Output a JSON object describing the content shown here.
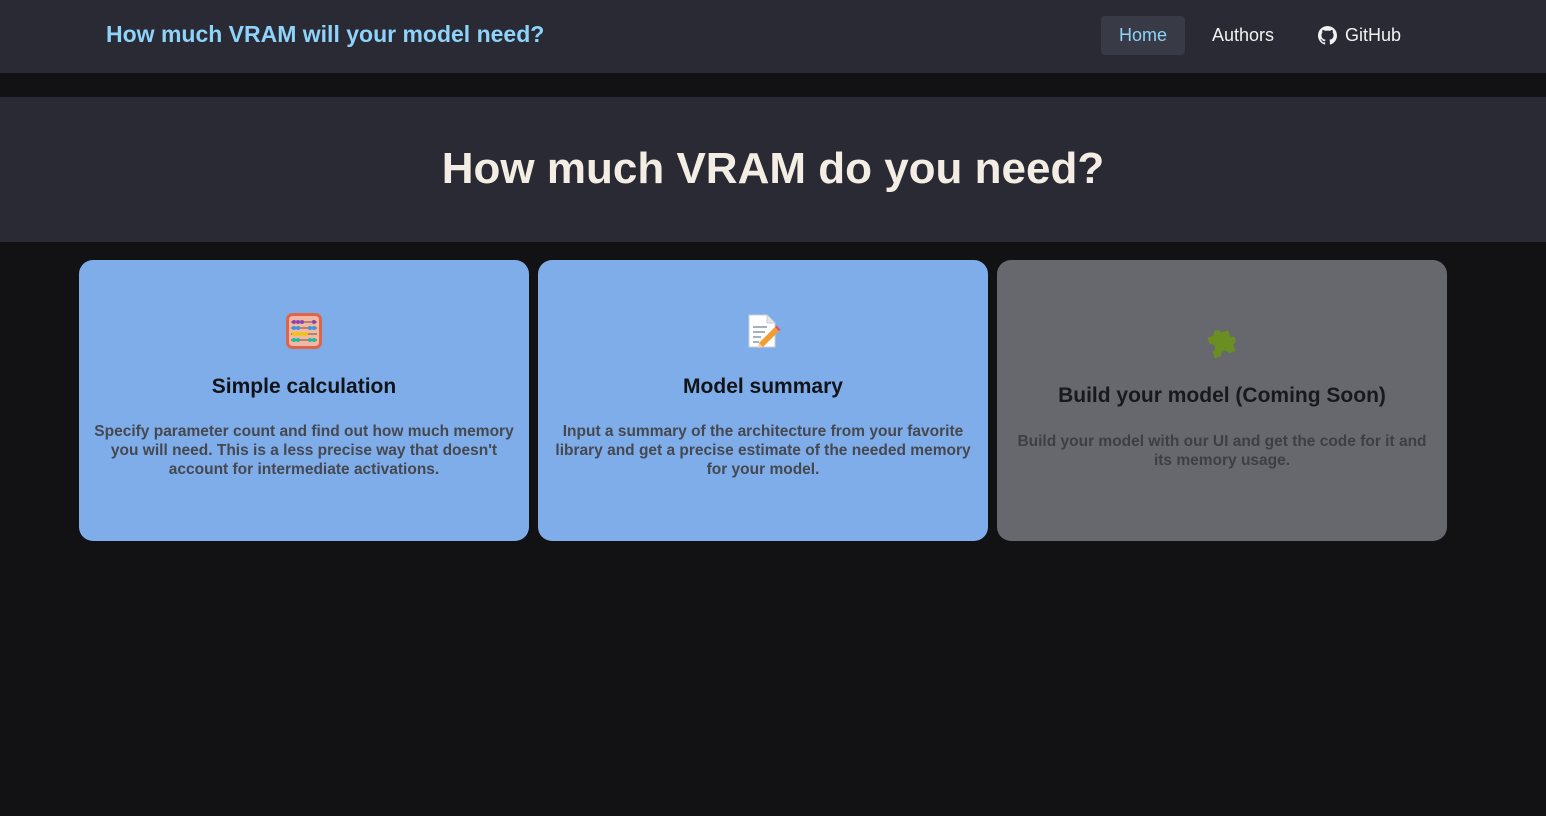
{
  "navbar": {
    "brand": "How much VRAM will your model need?",
    "items": [
      {
        "label": "Home",
        "active": true
      },
      {
        "label": "Authors"
      },
      {
        "label": "GitHub",
        "icon": "github-icon"
      }
    ]
  },
  "hero": {
    "title": "How much VRAM do you need?"
  },
  "cards": [
    {
      "icon": "abacus-icon",
      "title": "Simple calculation",
      "description": "Specify parameter count and find out how much memory you will need. This is a less precise way that doesn't account for intermediate activations."
    },
    {
      "icon": "memo-icon",
      "title": "Model summary",
      "description": "Input a summary of the architecture from your favorite library and get a precise estimate of the needed memory for your model."
    },
    {
      "icon": "puzzle-piece-icon",
      "title": "Build your model (Coming Soon)",
      "description": "Build your model with our UI and get the code for it and its memory usage."
    }
  ],
  "colors": {
    "background": "#121214",
    "navbar": "#292a33",
    "brand": "#8fd3fa",
    "card_active": "#7fadea",
    "card_disabled": "#66686e",
    "hero_text": "#f3ede3"
  }
}
